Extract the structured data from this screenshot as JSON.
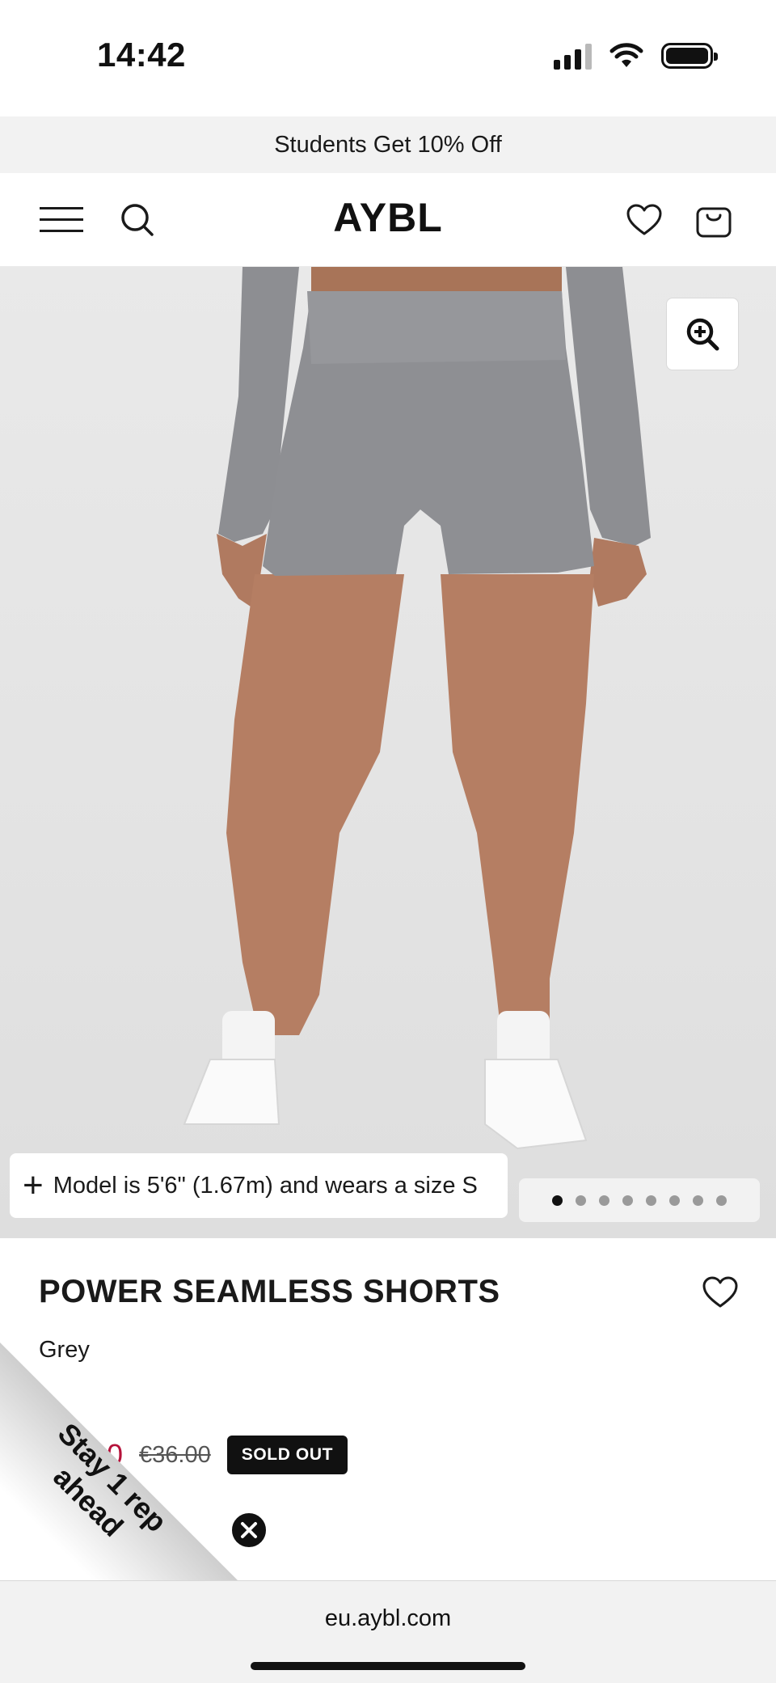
{
  "status_bar": {
    "time": "14:42"
  },
  "promo_banner": {
    "text": "Students Get 10% Off"
  },
  "header": {
    "logo": "AYBL"
  },
  "product_image": {
    "model_note": "Model is 5'6\" (1.67m) and wears a size S",
    "gallery": {
      "total_images": 8,
      "active_index": 0
    }
  },
  "product": {
    "title": "POWER SEAMLESS SHORTS",
    "colour": "Grey",
    "price_sale_visible": "10",
    "price_original": "€36.00",
    "status_badge": "SOLD OUT"
  },
  "promo_ribbon": {
    "text": "Stay 1 rep ahead"
  },
  "browser": {
    "url": "eu.aybl.com"
  },
  "colors": {
    "sale_price": "#b5123a",
    "badge_bg": "#111111",
    "promo_bg": "#f2f2f2"
  }
}
